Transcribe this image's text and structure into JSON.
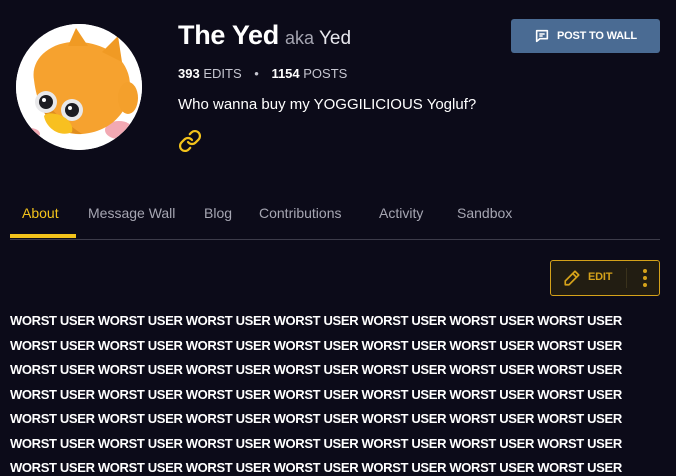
{
  "profile": {
    "display_name": "The Yed",
    "aka_label": "aka",
    "aka_name": "Yed",
    "edits_count": "393",
    "edits_label": "EDITS",
    "stats_separator": "•",
    "posts_count": "1154",
    "posts_label": "POSTS",
    "bio": "Who wanna buy my YOGGILICIOUS Yogluf?"
  },
  "actions": {
    "post_to_wall_label": "POST TO WALL",
    "edit_label": "EDIT"
  },
  "tabs": [
    {
      "label": "About",
      "active": true
    },
    {
      "label": "Message Wall",
      "active": false
    },
    {
      "label": "Blog",
      "active": false
    },
    {
      "label": "Contributions",
      "active": false
    },
    {
      "label": "Activity",
      "active": false
    },
    {
      "label": "Sandbox",
      "active": false
    }
  ],
  "content": {
    "lines": [
      "WORST USER WORST USER WORST USER WORST USER WORST USER WORST USER WORST USER",
      "WORST USER WORST USER WORST USER WORST USER WORST USER WORST USER WORST USER",
      "WORST USER WORST USER WORST USER WORST USER WORST USER WORST USER WORST USER",
      "WORST USER WORST USER WORST USER WORST USER WORST USER WORST USER WORST USER",
      "WORST USER WORST USER WORST USER WORST USER WORST USER WORST USER WORST USER",
      "WORST USER WORST USER WORST USER WORST USER WORST USER WORST USER WORST USER",
      "WORST USER WORST USER WORST USER WORST USER WORST USER WORST USER WORST USER"
    ]
  },
  "icons": {
    "post_to_wall": "message-square-icon",
    "link": "link-icon",
    "edit": "pencil-icon",
    "more": "more-vertical-icon"
  },
  "colors": {
    "background": "#0c0b19",
    "accent": "#f3c31b",
    "post_button": "#4a6b93",
    "edit_border": "#d5a21a",
    "tab_inactive": "#a6a6b2"
  }
}
